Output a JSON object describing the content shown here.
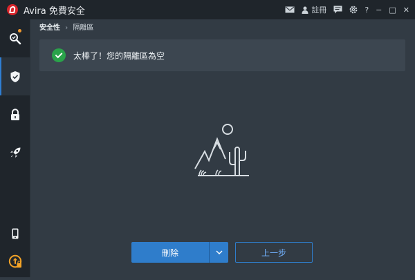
{
  "app": {
    "title": "Avira 免費安全",
    "register_label": "註冊"
  },
  "window_controls": {
    "help": "?",
    "minimize": "−",
    "maximize": "□",
    "close": "✕"
  },
  "breadcrumb": {
    "section": "安全性",
    "separator": "›",
    "page": "隔離區"
  },
  "banner": {
    "message": "太棒了！您的隔離區為空"
  },
  "buttons": {
    "delete_label": "刪除",
    "back_label": "上一步"
  },
  "colors": {
    "accent": "#2f7dcb",
    "success": "#2aa34a",
    "alert_dot": "#f29a2e",
    "brand_red": "#d9252b"
  },
  "icons": {
    "rail": [
      "search-scan-icon",
      "shield-check-icon",
      "lock-icon",
      "rocket-icon",
      "mobile-icon",
      "upgrade-icon"
    ]
  }
}
